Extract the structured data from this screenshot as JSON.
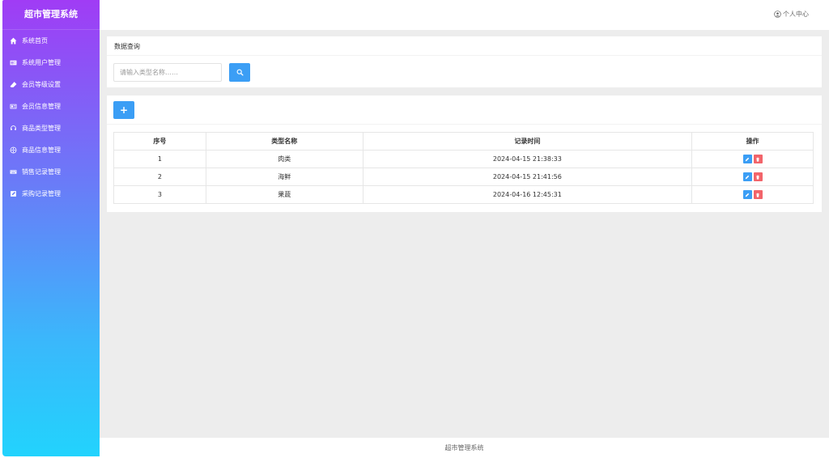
{
  "app": {
    "title": "超市管理系统"
  },
  "sidebar": {
    "items": [
      {
        "label": "系统首页",
        "icon": "home-icon"
      },
      {
        "label": "系统用户管理",
        "icon": "id-card-icon"
      },
      {
        "label": "会员等级设置",
        "icon": "eraser-icon"
      },
      {
        "label": "会员信息管理",
        "icon": "id-card-icon"
      },
      {
        "label": "商品类型管理",
        "icon": "headset-icon"
      },
      {
        "label": "商品信息管理",
        "icon": "globe-icon"
      },
      {
        "label": "销售记录管理",
        "icon": "keyboard-icon"
      },
      {
        "label": "采购记录管理",
        "icon": "edit-icon"
      }
    ]
  },
  "header": {
    "personal_center": "个人中心"
  },
  "search": {
    "title": "数据查询",
    "placeholder": "请输入类型名称……"
  },
  "toolbar": {
    "add_label": "+"
  },
  "table": {
    "headers": [
      "序号",
      "类型名称",
      "记录时间",
      "操作"
    ],
    "rows": [
      {
        "index": "1",
        "name": "肉类",
        "time": "2024-04-15 21:38:33"
      },
      {
        "index": "2",
        "name": "海鲜",
        "time": "2024-04-15 21:41:56"
      },
      {
        "index": "3",
        "name": "果蔬",
        "time": "2024-04-16 12:45:31"
      }
    ]
  },
  "footer": {
    "text": "超市管理系统"
  },
  "colors": {
    "primary": "#3b9ef5",
    "danger": "#f2646a",
    "sidebar_top": "#a03cf5",
    "sidebar_bottom": "#22d3fd"
  }
}
